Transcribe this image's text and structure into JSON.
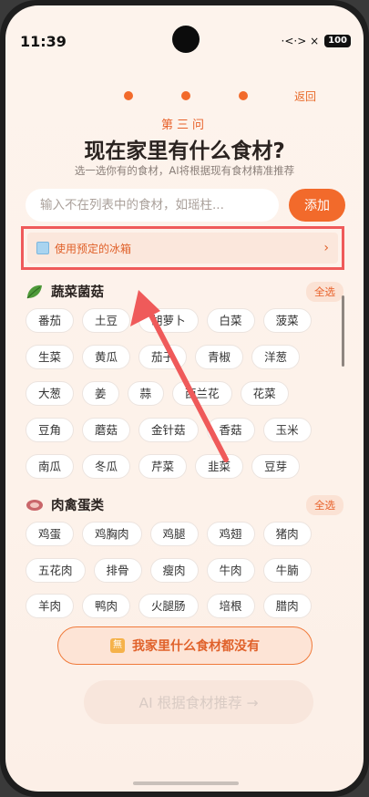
{
  "status": {
    "time": "11:39",
    "signal": "·<·> ×",
    "battery": "100"
  },
  "header": {
    "back": "返回",
    "step": "第三问",
    "title": "现在家里有什么食材?",
    "subtitle": "选一选你有的食材，AI将根据现有食材精准推荐"
  },
  "search": {
    "placeholder": "输入不在列表中的食材，如瑶柱...",
    "add": "添加"
  },
  "fridge": {
    "label": "使用预定的冰箱",
    "chevron": "›"
  },
  "veg": {
    "title": "蔬菜菌菇",
    "select_all": "全选",
    "rows": [
      [
        "番茄",
        "土豆",
        "胡萝卜",
        "白菜",
        "菠菜"
      ],
      [
        "生菜",
        "黄瓜",
        "茄子",
        "青椒",
        "洋葱"
      ],
      [
        "大葱",
        "姜",
        "蒜",
        "西兰花",
        "花菜"
      ],
      [
        "豆角",
        "蘑菇",
        "金针菇",
        "香菇",
        "玉米"
      ],
      [
        "南瓜",
        "冬瓜",
        "芹菜",
        "韭菜",
        "豆芽"
      ]
    ]
  },
  "meat": {
    "title": "肉禽蛋类",
    "select_all": "全选",
    "rows": [
      [
        "鸡蛋",
        "鸡胸肉",
        "鸡腿",
        "鸡翅",
        "猪肉"
      ],
      [
        "五花肉",
        "排骨",
        "瘦肉",
        "牛肉",
        "牛腩"
      ],
      [
        "羊肉",
        "鸭肉",
        "火腿肠",
        "培根",
        "腊肉"
      ]
    ]
  },
  "empty_button": {
    "icon": "無",
    "label": "我家里什么食材都没有"
  },
  "ai_button": "AI 根据食材推荐 →",
  "colors": {
    "accent": "#f26a2b",
    "highlight": "#ef5a5a"
  }
}
